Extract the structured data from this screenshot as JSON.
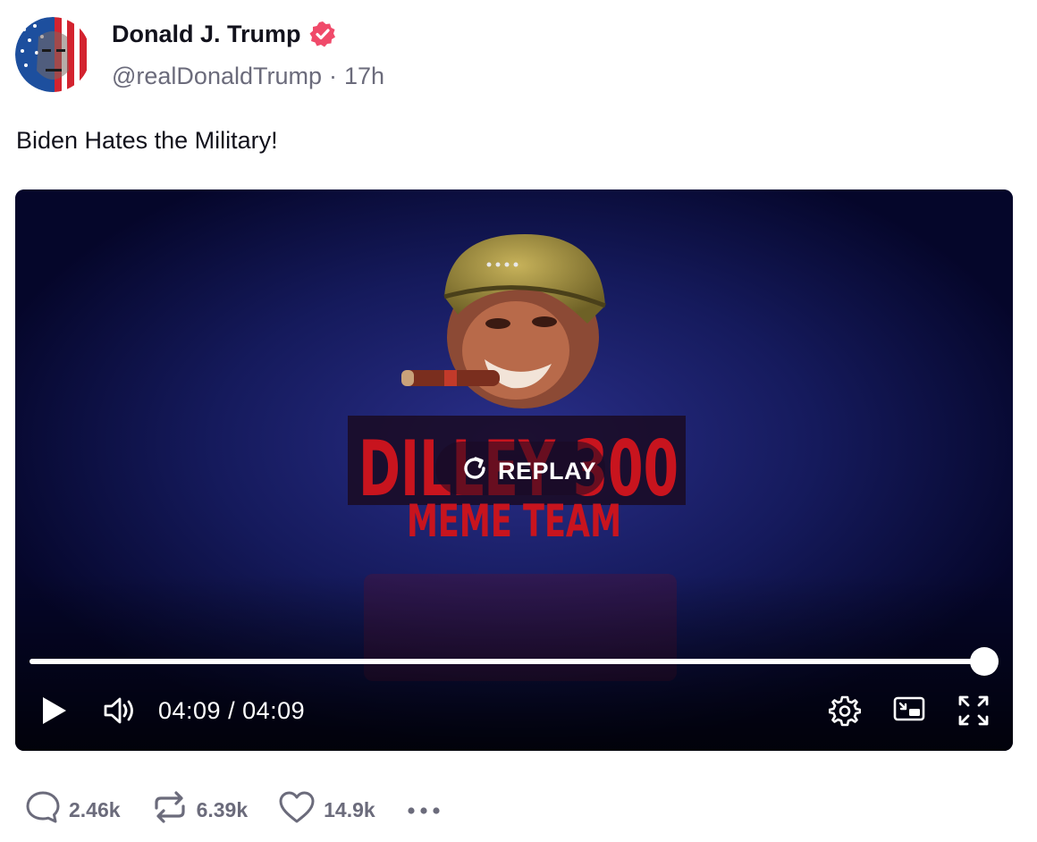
{
  "post": {
    "display_name": "Donald J. Trump",
    "verified_icon": "verified-badge-icon",
    "handle": "@realDonaldTrump",
    "separator": "·",
    "time_ago": "17h",
    "text": "Biden Hates the Military!"
  },
  "video": {
    "replay_label": "REPLAY",
    "time_current": "04:09",
    "time_total": "04:09",
    "progress": 1.0,
    "watermark_line1": "DILLEY 300",
    "watermark_line2": "MEME TEAM"
  },
  "actions": {
    "replies": "2.46k",
    "reposts": "6.39k",
    "likes": "14.9k"
  },
  "colors": {
    "verified": "#f04a6a",
    "muted_text": "#6b6b7b",
    "video_bg": "#080a2e"
  }
}
